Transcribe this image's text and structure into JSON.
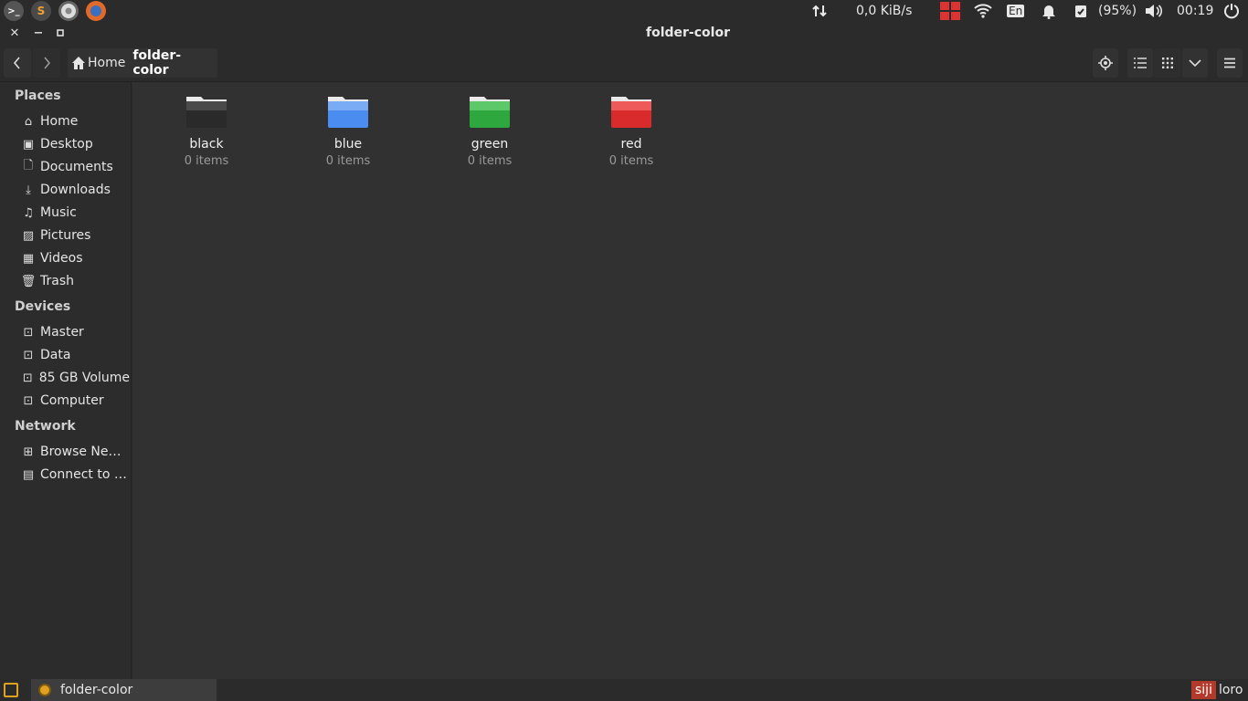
{
  "panel": {
    "net_speed": "0,0 KiB/s",
    "keyboard_layout": "En",
    "battery": "(95%)",
    "clock": "00:19",
    "launcher_s": "S"
  },
  "window": {
    "title": "folder-color"
  },
  "toolbar": {
    "breadcrumbs": [
      {
        "label": "Home"
      },
      {
        "label": "folder-color"
      }
    ]
  },
  "sidebar": {
    "places_title": "Places",
    "places": [
      {
        "label": "Home",
        "icon": "home-icon"
      },
      {
        "label": "Desktop",
        "icon": "desktop-icon"
      },
      {
        "label": "Documents",
        "icon": "documents-icon"
      },
      {
        "label": "Downloads",
        "icon": "downloads-icon"
      },
      {
        "label": "Music",
        "icon": "music-icon"
      },
      {
        "label": "Pictures",
        "icon": "pictures-icon"
      },
      {
        "label": "Videos",
        "icon": "videos-icon"
      },
      {
        "label": "Trash",
        "icon": "trash-icon"
      }
    ],
    "devices_title": "Devices",
    "devices": [
      {
        "label": "Master",
        "icon": "drive-icon"
      },
      {
        "label": "Data",
        "icon": "drive-icon"
      },
      {
        "label": "85 GB Volume",
        "icon": "drive-icon"
      },
      {
        "label": "Computer",
        "icon": "drive-icon"
      }
    ],
    "network_title": "Network",
    "network": [
      {
        "label": "Browse Ne…",
        "icon": "network-icon"
      },
      {
        "label": "Connect to …",
        "icon": "server-icon"
      }
    ]
  },
  "folders": [
    {
      "name": "black",
      "count": "0 items",
      "color": "#2a2a2a"
    },
    {
      "name": "blue",
      "count": "0 items",
      "color": "#4a8cf0"
    },
    {
      "name": "green",
      "count": "0 items",
      "color": "#3bb54a"
    },
    {
      "name": "red",
      "count": "0 items",
      "color": "#e03434"
    }
  ],
  "taskbar": {
    "task_label": "folder-color",
    "user_first": "siji",
    "user_second": "loro"
  }
}
